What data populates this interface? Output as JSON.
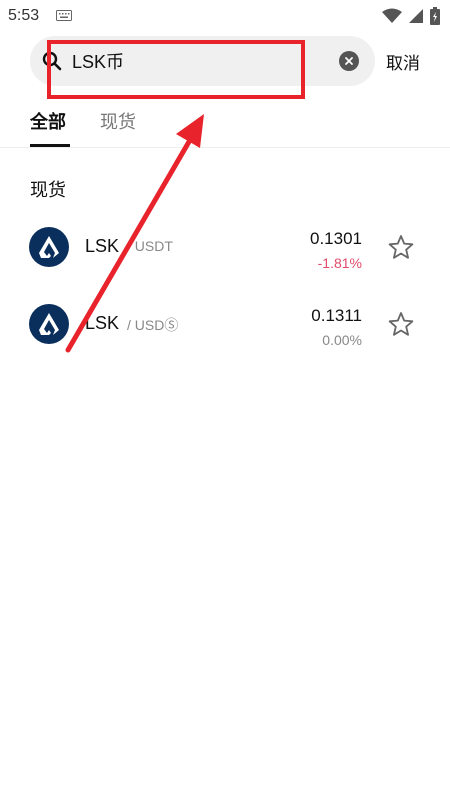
{
  "status_bar": {
    "time": "5:53"
  },
  "search": {
    "value": "LSK币",
    "cancel_label": "取消"
  },
  "tabs": [
    {
      "label": "全部",
      "active": true
    },
    {
      "label": "现货",
      "active": false
    }
  ],
  "section": {
    "title": "现货"
  },
  "results": [
    {
      "base": "LSK",
      "quote": "/ USDT",
      "price": "0.1301",
      "change": "-1.81%",
      "change_color": "#e24b6a"
    },
    {
      "base": "LSK",
      "quote": "/ USDⓈ",
      "price": "0.1311",
      "change": "0.00%",
      "change_color": "#888888"
    }
  ],
  "colors": {
    "annotation": "#e8232b",
    "coin_logo": "#0a2f5d"
  }
}
